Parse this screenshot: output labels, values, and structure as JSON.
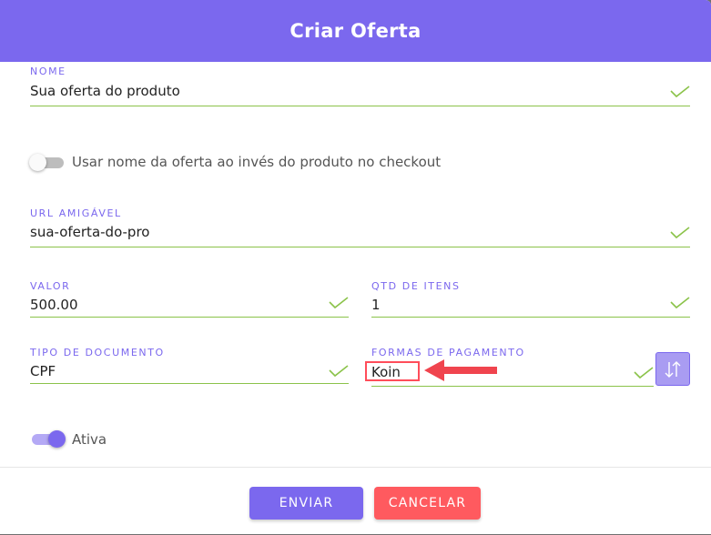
{
  "dialog": {
    "title": "Criar Oferta"
  },
  "fields": {
    "nome": {
      "label": "NOME",
      "value": "Sua oferta do produto"
    },
    "url": {
      "label": "URL AMIGÁVEL",
      "value": "sua-oferta-do-pro"
    },
    "valor": {
      "label": "VALOR",
      "value": "500.00"
    },
    "qtd": {
      "label": "QTD DE ITENS",
      "value": "1"
    },
    "tipo_doc": {
      "label": "TIPO DE DOCUMENTO",
      "value": "CPF"
    },
    "formas_pag": {
      "label": "FORMAS DE PAGAMENTO",
      "value": "Koin"
    }
  },
  "toggles": {
    "usar_nome": {
      "label": "Usar nome da oferta ao invés do produto no checkout",
      "on": false
    },
    "ativa": {
      "label": "Ativa",
      "on": true
    }
  },
  "buttons": {
    "submit": "ENVIAR",
    "cancel": "CANCELAR"
  },
  "colors": {
    "accent": "#7b68ee",
    "valid": "#8bc34a",
    "cancel": "#ff5a5f",
    "annotation": "#ff4d5a"
  },
  "icons": {
    "valid": "check-icon",
    "sort": "sort-arrows-icon",
    "annotation": "arrow-left-icon"
  }
}
